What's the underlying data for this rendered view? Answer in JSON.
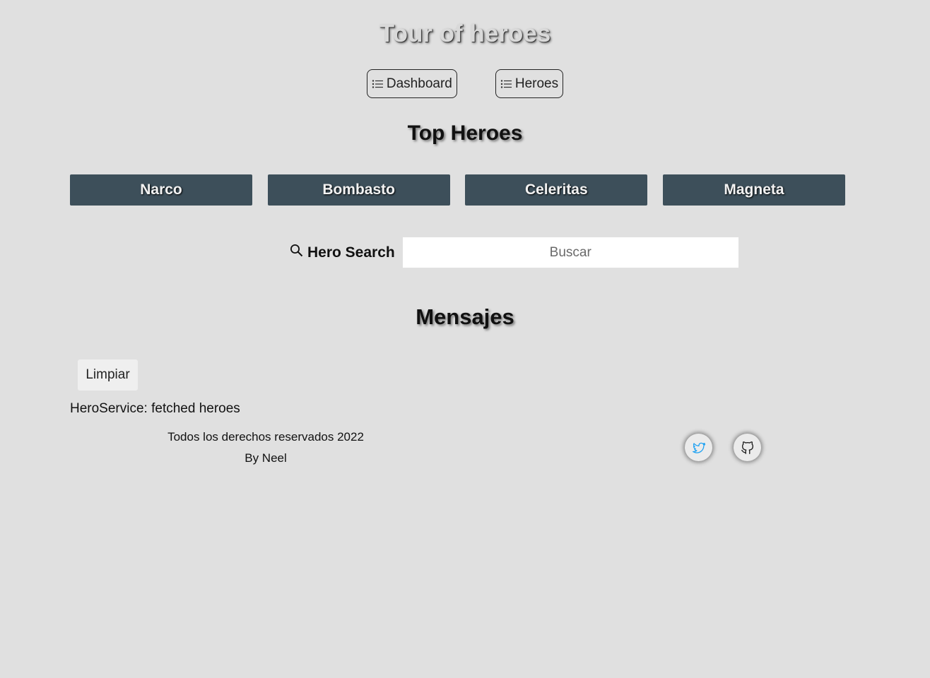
{
  "header": {
    "title": "Tour of heroes"
  },
  "nav": {
    "dashboard_label": "Dashboard",
    "heroes_label": "Heroes"
  },
  "dashboard": {
    "title": "Top Heroes",
    "heroes": [
      "Narco",
      "Bombasto",
      "Celeritas",
      "Magneta"
    ]
  },
  "search": {
    "label": "Hero Search",
    "placeholder": "Buscar",
    "value": ""
  },
  "messages": {
    "title": "Mensajes",
    "clear_label": "Limpiar",
    "items": [
      "HeroService: fetched heroes"
    ]
  },
  "footer": {
    "copyright": "Todos los derechos reservados 2022",
    "author": "By Neel"
  },
  "colors": {
    "background": "#e0e0e0",
    "hero_card": "#3d4f5a",
    "twitter_icon": "#1da1f2"
  },
  "icons": {
    "nav": "list-icon",
    "search": "search-icon",
    "social": [
      "twitter-icon",
      "github-icon"
    ]
  }
}
